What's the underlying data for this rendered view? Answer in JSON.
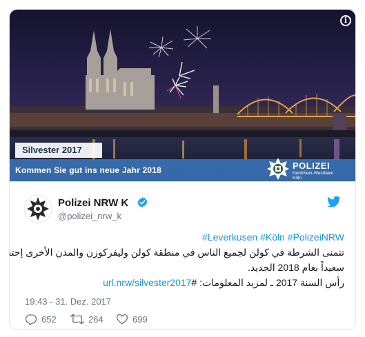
{
  "media": {
    "label_tag": "Silvester 2017",
    "greeting": "Kommen Sie gut ins neue Jahr 2018",
    "police_name": "POLIZEI",
    "police_region": "Nordrhein-Westfalen",
    "police_city": "Köln"
  },
  "author": {
    "display_name": "Polizei NRW K",
    "handle": "@polizei_nrw_k",
    "verified": true
  },
  "tweet": {
    "hashtags": "#Leverkusen #Köln #PolizeiNRW",
    "body_line1": "تتمنى الشرطة في كولن لجميع الناس في منطقة كولن وليفركوزن والمدن الأخرى إحتفالاً",
    "body_line2": "سعيداً بعام 2018 الجديد.",
    "body_line3_text": "رأس السنة 2017 ـ لمزيد المعلومات: #",
    "body_line3_link": "url.nrw/silvester2017"
  },
  "meta": {
    "timestamp": "19:43 - 31. Dez. 2017"
  },
  "actions": {
    "replies": "652",
    "retweets": "264",
    "likes": "699"
  },
  "icons": [
    "info-icon",
    "police-star-icon",
    "verified-badge-icon",
    "twitter-bird-icon",
    "reply-icon",
    "retweet-icon",
    "like-icon"
  ],
  "colors": {
    "link": "#1b95e0",
    "muted": "#657786",
    "banner": "#3c78be",
    "verified": "#1da1f2"
  }
}
